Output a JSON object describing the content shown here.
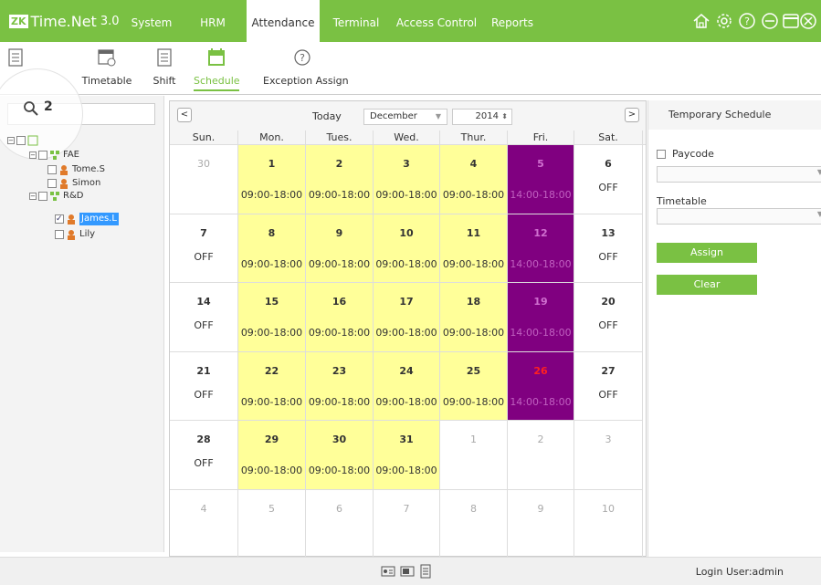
{
  "app": {
    "logo_badge": "ZK",
    "name": "Time.Net",
    "version": "3.0"
  },
  "menu": [
    {
      "label": "System"
    },
    {
      "label": "HRM"
    },
    {
      "label": "Attendance"
    },
    {
      "label": "Terminal"
    },
    {
      "label": "Access Control"
    },
    {
      "label": "Reports"
    }
  ],
  "toolbar": [
    {
      "label": ""
    },
    {
      "label": "Timetable"
    },
    {
      "label": "Shift"
    },
    {
      "label": "Schedule"
    },
    {
      "label": "Exception Assign"
    }
  ],
  "search": {
    "value": "2"
  },
  "tree": {
    "dept1": "FAE",
    "emp1": "Tome.S",
    "emp2": "Simon",
    "dept2": "R&D",
    "emp3": "James.L",
    "emp4": "Lily"
  },
  "calendar": {
    "today_label": "Today",
    "month": "December",
    "year": "2014",
    "weekdays": [
      "Sun.",
      "Mon.",
      "Tues.",
      "Wed.",
      "Thur.",
      "Fri.",
      "Sat."
    ],
    "weeks": [
      [
        {
          "day": "30",
          "other": true
        },
        {
          "day": "1",
          "time": "09:00-18:00",
          "kind": "yellow"
        },
        {
          "day": "2",
          "time": "09:00-18:00",
          "kind": "yellow"
        },
        {
          "day": "3",
          "time": "09:00-18:00",
          "kind": "yellow"
        },
        {
          "day": "4",
          "time": "09:00-18:00",
          "kind": "yellow"
        },
        {
          "day": "5",
          "time": "14:00-18:00",
          "kind": "purple"
        },
        {
          "day": "6",
          "off": "OFF"
        }
      ],
      [
        {
          "day": "7",
          "off": "OFF"
        },
        {
          "day": "8",
          "time": "09:00-18:00",
          "kind": "yellow"
        },
        {
          "day": "9",
          "time": "09:00-18:00",
          "kind": "yellow"
        },
        {
          "day": "10",
          "time": "09:00-18:00",
          "kind": "yellow"
        },
        {
          "day": "11",
          "time": "09:00-18:00",
          "kind": "yellow"
        },
        {
          "day": "12",
          "time": "14:00-18:00",
          "kind": "purple"
        },
        {
          "day": "13",
          "off": "OFF"
        }
      ],
      [
        {
          "day": "14",
          "off": "OFF"
        },
        {
          "day": "15",
          "time": "09:00-18:00",
          "kind": "yellow"
        },
        {
          "day": "16",
          "time": "09:00-18:00",
          "kind": "yellow"
        },
        {
          "day": "17",
          "time": "09:00-18:00",
          "kind": "yellow"
        },
        {
          "day": "18",
          "time": "09:00-18:00",
          "kind": "yellow"
        },
        {
          "day": "19",
          "time": "14:00-18:00",
          "kind": "purple"
        },
        {
          "day": "20",
          "off": "OFF"
        }
      ],
      [
        {
          "day": "21",
          "off": "OFF"
        },
        {
          "day": "22",
          "time": "09:00-18:00",
          "kind": "yellow"
        },
        {
          "day": "23",
          "time": "09:00-18:00",
          "kind": "yellow"
        },
        {
          "day": "24",
          "time": "09:00-18:00",
          "kind": "yellow"
        },
        {
          "day": "25",
          "time": "09:00-18:00",
          "kind": "yellow"
        },
        {
          "day": "26",
          "time": "14:00-18:00",
          "kind": "purple",
          "red": true
        },
        {
          "day": "27",
          "off": "OFF"
        }
      ],
      [
        {
          "day": "28",
          "off": "OFF"
        },
        {
          "day": "29",
          "time": "09:00-18:00",
          "kind": "yellow"
        },
        {
          "day": "30",
          "time": "09:00-18:00",
          "kind": "yellow"
        },
        {
          "day": "31",
          "time": "09:00-18:00",
          "kind": "yellow"
        },
        {
          "day": "1",
          "other": true
        },
        {
          "day": "2",
          "other": true
        },
        {
          "day": "3",
          "other": true
        }
      ],
      [
        {
          "day": "4",
          "other": true
        },
        {
          "day": "5",
          "other": true
        },
        {
          "day": "6",
          "other": true
        },
        {
          "day": "7",
          "other": true
        },
        {
          "day": "8",
          "other": true
        },
        {
          "day": "9",
          "other": true
        },
        {
          "day": "10",
          "other": true
        }
      ]
    ]
  },
  "right_panel": {
    "title": "Temporary Schedule",
    "paycode_label": "Paycode",
    "timetable_label": "Timetable",
    "assign_label": "Assign",
    "clear_label": "Clear"
  },
  "footer": {
    "login_user": "Login User:admin"
  },
  "colors": {
    "brand_green": "#7ac143",
    "workday_yellow": "#ffff99",
    "shortday_purple": "#800080"
  }
}
